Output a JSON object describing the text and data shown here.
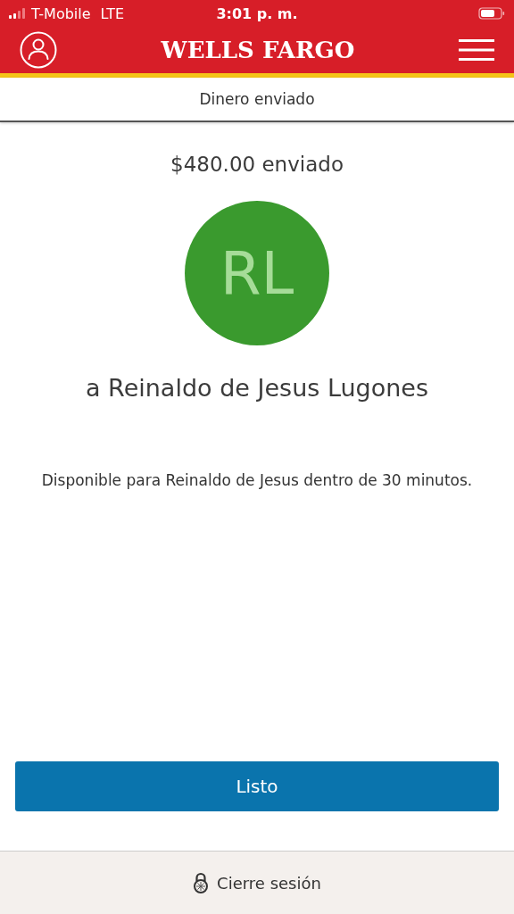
{
  "status_bar": {
    "carrier": "T-Mobile",
    "network": "LTE",
    "time": "3:01 p. m."
  },
  "header": {
    "logo": "WELLS FARGO"
  },
  "page_title": "Dinero enviado",
  "amount": "$480.00 enviado",
  "recipient": {
    "initials": "RL",
    "name": "a Reinaldo de Jesus Lugones",
    "color": "#3a9a2e"
  },
  "message": "Disponible para Reinaldo de Jesus dentro de 30 minutos.",
  "done_button": "Listo",
  "footer": {
    "signout": "Cierre sesión"
  }
}
